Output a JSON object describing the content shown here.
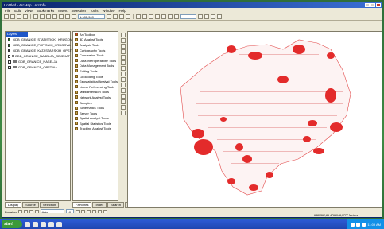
{
  "window": {
    "title": "Untitled - ArcMap - ArcInfo"
  },
  "menu": [
    "File",
    "Edit",
    "View",
    "Bookmarks",
    "Insert",
    "Selection",
    "Tools",
    "Window",
    "Help"
  ],
  "toolbar": {
    "scale": "1:181,969",
    "layer_select": ""
  },
  "toc": {
    "header": "Layers",
    "layers": [
      {
        "label": "GDB_GRANICE_STATISTICKI_KRUGOVI",
        "checked": true
      },
      {
        "label": "GDB_GRANICE_POPISNIH_KRUGOVA",
        "checked": true
      },
      {
        "label": "GDB_GRANICE_KATASTARSKIH_OPSTINA",
        "checked": false
      },
      {
        "label": "GDB_GRANICE_NASELJA_OBJEKAT",
        "checked": false
      },
      {
        "label": "GDB_GRANICE_NASELJA",
        "checked": false
      },
      {
        "label": "GDB_GRANICE_OPSTINA",
        "checked": false
      }
    ],
    "tabs": [
      "Display",
      "Source",
      "Selection"
    ]
  },
  "arctoolbox": {
    "header": "ArcToolbox",
    "items": [
      "3D Analyst Tools",
      "Analysis Tools",
      "Cartography Tools",
      "Conversion Tools",
      "Data Interoperability Tools",
      "Data Management Tools",
      "Editing Tools",
      "Geocoding Tools",
      "Geostatistical Analyst Tools",
      "Linear Referencing Tools",
      "Multidimension Tools",
      "Network Analyst Tools",
      "Samples",
      "Schematics Tools",
      "Server Tools",
      "Spatial Analyst Tools",
      "Spatial Statistics Tools",
      "Tracking Analyst Tools"
    ],
    "tabs": [
      "Favorites",
      "Index",
      "Search",
      "Results"
    ]
  },
  "drawing": {
    "label": "Drawing",
    "font": "Arial",
    "size": "10"
  },
  "status": {
    "coords": "6480362,85 4768048,0777 Meters"
  },
  "taskbar": {
    "start": "start",
    "clock": "11:09 AM"
  },
  "colors": {
    "polygon_fill": "#e32b2b",
    "label_color": "#e04040",
    "accent": "#0a246a"
  }
}
